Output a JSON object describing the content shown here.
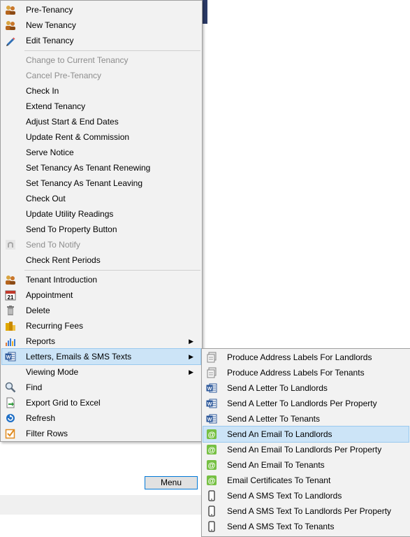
{
  "main_menu": {
    "groups": [
      [
        {
          "label": "Pre-Tenancy",
          "icon": "people-icon",
          "disabled": false
        },
        {
          "label": "New Tenancy",
          "icon": "people-icon",
          "disabled": false
        },
        {
          "label": "Edit Tenancy",
          "icon": "pencil-icon",
          "disabled": false
        }
      ],
      [
        {
          "label": "Change to Current Tenancy",
          "icon": null,
          "disabled": true
        },
        {
          "label": "Cancel Pre-Tenancy",
          "icon": null,
          "disabled": true
        },
        {
          "label": "Check In",
          "icon": null,
          "disabled": false
        },
        {
          "label": "Extend Tenancy",
          "icon": null,
          "disabled": false
        },
        {
          "label": "Adjust Start & End Dates",
          "icon": null,
          "disabled": false
        },
        {
          "label": "Update Rent & Commission",
          "icon": null,
          "disabled": false
        },
        {
          "label": "Serve Notice",
          "icon": null,
          "disabled": false
        },
        {
          "label": "Set Tenancy As Tenant Renewing",
          "icon": null,
          "disabled": false
        },
        {
          "label": "Set Tenancy As Tenant Leaving",
          "icon": null,
          "disabled": false
        },
        {
          "label": "Check Out",
          "icon": null,
          "disabled": false
        },
        {
          "label": "Update Utility Readings",
          "icon": null,
          "disabled": false
        },
        {
          "label": "Send To Property Button",
          "icon": null,
          "disabled": false
        },
        {
          "label": "Send To Notify",
          "icon": "notify-icon",
          "disabled": true
        },
        {
          "label": "Check Rent Periods",
          "icon": null,
          "disabled": false
        }
      ],
      [
        {
          "label": "Tenant Introduction",
          "icon": "people-icon",
          "disabled": false
        },
        {
          "label": "Appointment",
          "icon": "calendar-icon",
          "disabled": false
        },
        {
          "label": "Delete",
          "icon": "trash-icon",
          "disabled": false
        },
        {
          "label": "Recurring Fees",
          "icon": "coins-icon",
          "disabled": false
        },
        {
          "label": "Reports",
          "icon": "bar-chart-icon",
          "disabled": false,
          "submenu": true
        },
        {
          "label": "Letters, Emails & SMS Texts",
          "icon": "word-icon",
          "disabled": false,
          "submenu": true,
          "highlight": true
        },
        {
          "label": "Viewing Mode",
          "icon": null,
          "disabled": false,
          "submenu": true
        },
        {
          "label": "Find",
          "icon": "magnifier-icon",
          "disabled": false
        },
        {
          "label": "Export Grid to Excel",
          "icon": "export-icon",
          "disabled": false
        },
        {
          "label": "Refresh",
          "icon": "refresh-icon",
          "disabled": false
        },
        {
          "label": "Filter Rows",
          "icon": "filter-checkbox-icon",
          "disabled": false
        }
      ]
    ]
  },
  "sub_menu": {
    "items": [
      {
        "label": "Produce Address Labels For Landlords",
        "icon": "label-icon"
      },
      {
        "label": "Produce Address Labels For Tenants",
        "icon": "label-icon"
      },
      {
        "label": "Send A Letter To Landlords",
        "icon": "word-icon"
      },
      {
        "label": "Send A Letter To Landlords Per Property",
        "icon": "word-icon"
      },
      {
        "label": "Send A Letter To Tenants",
        "icon": "word-icon"
      },
      {
        "label": "Send An Email To Landlords",
        "icon": "email-icon",
        "highlight": true
      },
      {
        "label": "Send An Email To Landlords Per Property",
        "icon": "email-icon"
      },
      {
        "label": "Send An Email To Tenants",
        "icon": "email-icon"
      },
      {
        "label": "Email Certificates To Tenant",
        "icon": "email-icon"
      },
      {
        "label": "Send A SMS Text To Landlords",
        "icon": "phone-icon"
      },
      {
        "label": "Send A SMS Text To Landlords Per Property",
        "icon": "phone-icon"
      },
      {
        "label": "Send A SMS Text To Tenants",
        "icon": "phone-icon"
      }
    ]
  },
  "background": {
    "menu_button_label": "Menu"
  },
  "colors": {
    "highlight_bg": "#cce4f7",
    "highlight_border": "#99c9ef",
    "disabled_text": "#8d8d8d",
    "email_green": "#76c043",
    "word_blue": "#2b579a"
  },
  "glyphs": {
    "submenu_arrow": "▶",
    "email_at": "@",
    "word_w": "W",
    "calendar_day": "21"
  }
}
